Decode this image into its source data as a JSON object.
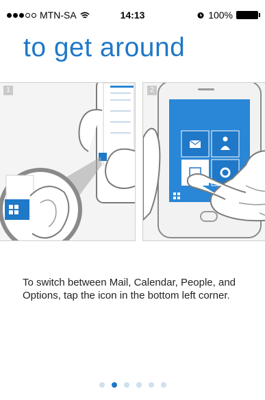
{
  "status_bar": {
    "carrier": "MTN-SA",
    "time": "14:13",
    "battery": "100%",
    "signal_dots": [
      true,
      true,
      true,
      false,
      false
    ]
  },
  "heading": "to get around",
  "panels": [
    {
      "number": "1"
    },
    {
      "number": "2"
    }
  ],
  "caption": "To switch between Mail, Calendar, People, and Options, tap the icon in the bottom left corner.",
  "pager": {
    "count": 6,
    "active": 1
  },
  "colors": {
    "accent": "#1f78c8",
    "tile": "#2a86d6"
  },
  "icons": [
    "wifi-icon",
    "alarm-icon",
    "battery-icon",
    "mail-icon",
    "people-icon",
    "calendar-icon",
    "settings-icon"
  ]
}
